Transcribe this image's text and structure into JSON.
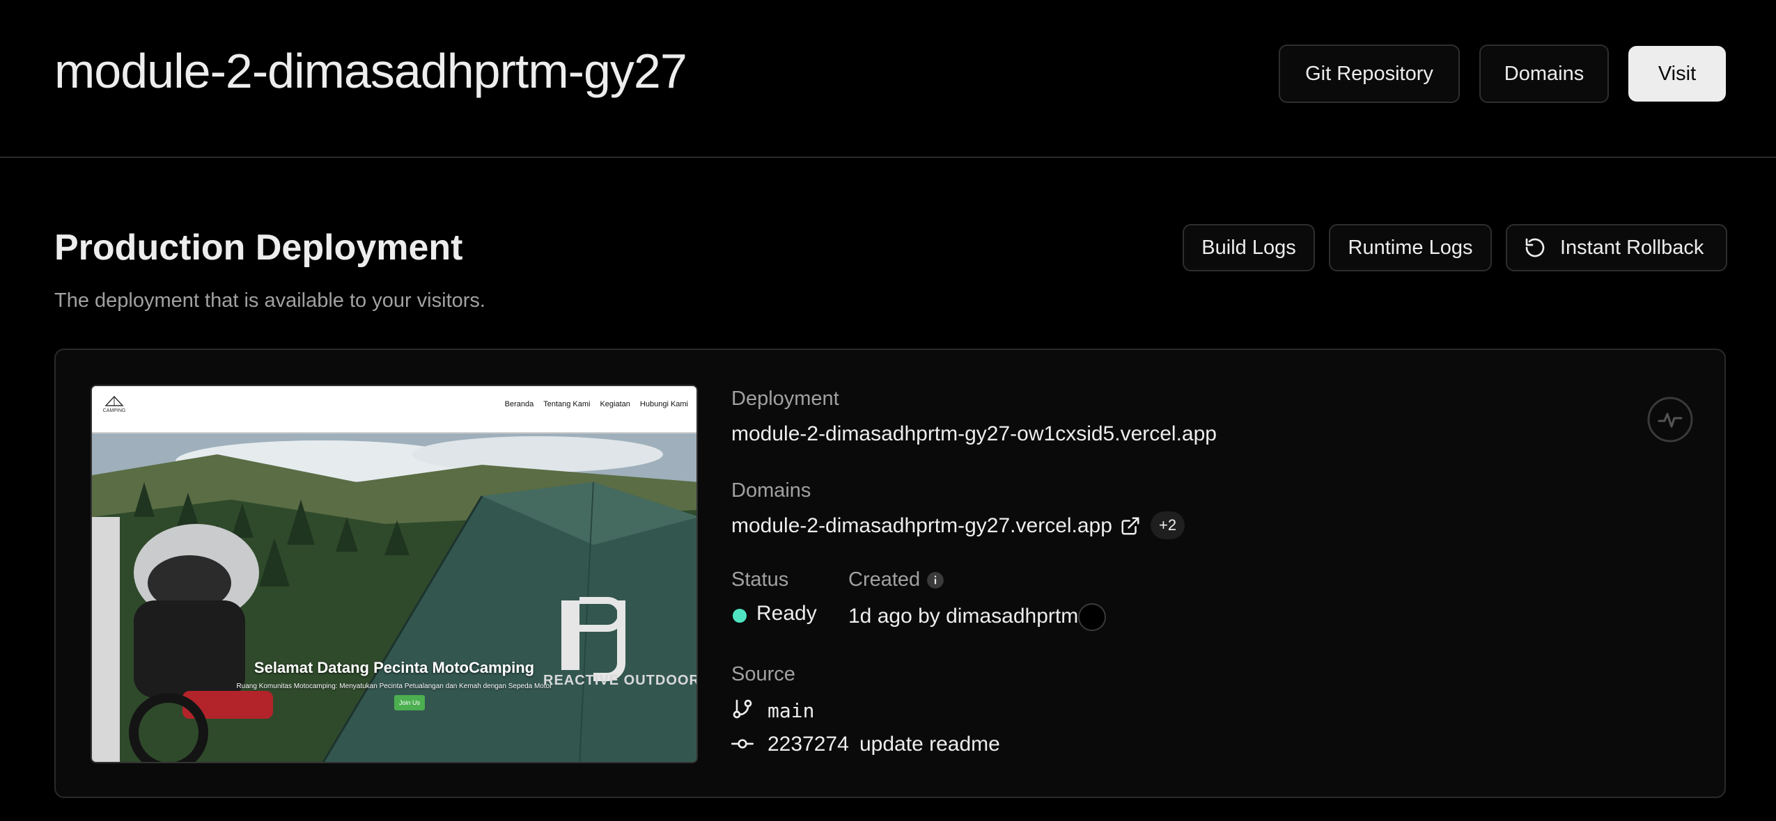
{
  "header": {
    "title": "module-2-dimasadhprtm-gy27",
    "git_repository_label": "Git Repository",
    "domains_label": "Domains",
    "visit_label": "Visit"
  },
  "production": {
    "title": "Production Deployment",
    "subtitle": "The deployment that is available to your visitors.",
    "build_logs_label": "Build Logs",
    "runtime_logs_label": "Runtime Logs",
    "instant_rollback_label": "Instant Rollback"
  },
  "preview": {
    "nav_links": [
      "Beranda",
      "Tentang Kami",
      "Kegiatan",
      "Hubungi Kami"
    ],
    "logo_text": "CAMPING",
    "hero_title": "Selamat Datang Pecinta MotoCamping",
    "hero_subtitle": "Ruang Komunitas Motocamping: Menyatukan Pecinta Petualangan dan Kemah dengan Sepeda Motor",
    "join_label": "Join Us",
    "brand_text": "REACTIVE OUTDOOR"
  },
  "deployment": {
    "deployment_label": "Deployment",
    "deployment_url": "module-2-dimasadhprtm-gy27-ow1cxsid5.vercel.app",
    "domains_label": "Domains",
    "domain_url": "module-2-dimasadhprtm-gy27.vercel.app",
    "extra_domains": "+2",
    "status_label": "Status",
    "status_value": "Ready",
    "status_color": "#50e3c2",
    "created_label": "Created",
    "created_value": "1d ago by dimasadhprtm",
    "source_label": "Source",
    "branch": "main",
    "commit_hash": "2237274",
    "commit_message": "update readme"
  },
  "icons": {
    "rollback": "rollback-icon",
    "external_link": "external-link-icon",
    "info": "info-icon",
    "branch": "git-branch-icon",
    "commit": "git-commit-icon",
    "activity": "activity-icon"
  }
}
